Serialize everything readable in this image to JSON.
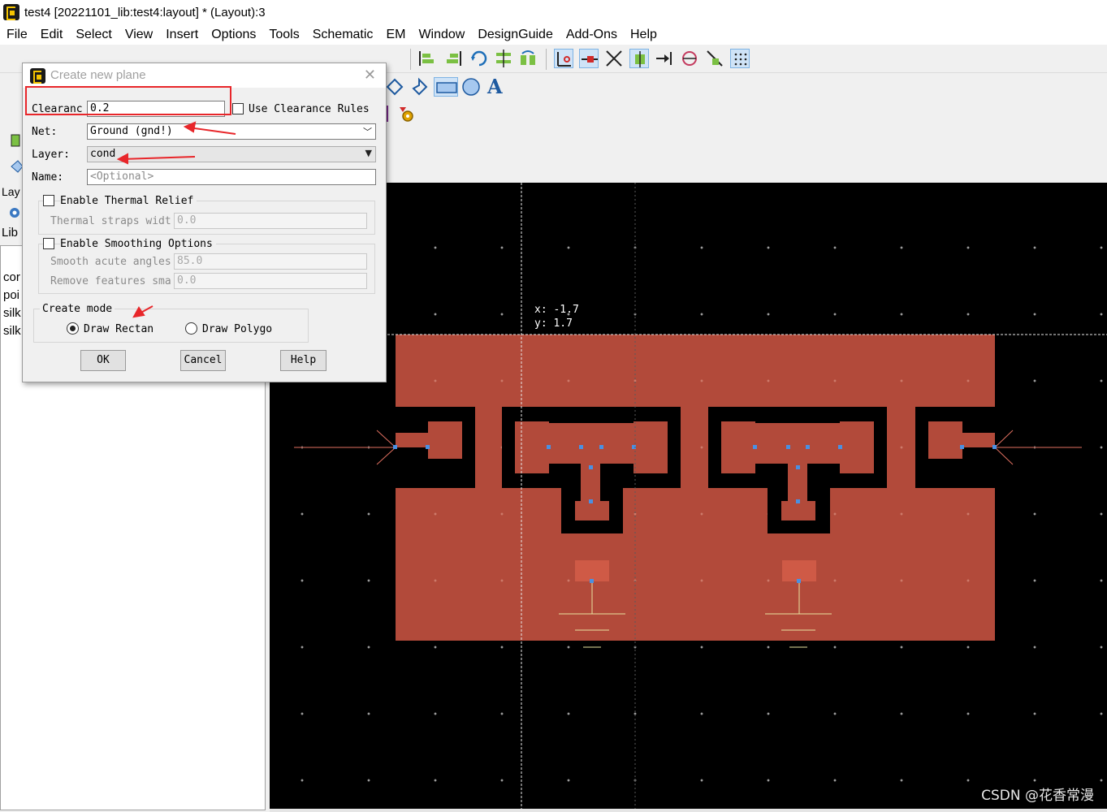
{
  "window": {
    "title": "test4 [20221101_lib:test4:layout] * (Layout):3"
  },
  "menubar": {
    "items": [
      "File",
      "Edit",
      "Select",
      "View",
      "Insert",
      "Options",
      "Tools",
      "Schematic",
      "EM",
      "Window",
      "DesignGuide",
      "Add-Ons",
      "Help"
    ]
  },
  "left_panel": {
    "tab_label": "Lay",
    "lib_label": "Lib",
    "items": [
      "cor",
      "poi",
      "silk",
      "silk"
    ]
  },
  "canvas": {
    "coord_x": "x: -1.7",
    "coord_y": "y: 1.7",
    "background": "#000000",
    "conductor_color": "#b24a3a",
    "pin_color": "#4a90e2",
    "ground_symbol_color": "#e8e4a0"
  },
  "dialog": {
    "title": "Create new plane",
    "clearance_label": "Clearanc",
    "clearance_value": "0.2",
    "use_clearance_rules_label": "Use Clearance Rules",
    "net_label": "Net:",
    "net_value": "Ground (gnd!)",
    "layer_label": "Layer:",
    "layer_value": "cond",
    "name_label": "Name:",
    "name_placeholder": "<Optional>",
    "thermal_relief_label": "Enable Thermal Relief",
    "thermal_straps_label": "Thermal straps widt",
    "thermal_straps_value": "0.0",
    "smoothing_label": "Enable Smoothing Options",
    "smooth_angles_label": "Smooth acute angles",
    "smooth_angles_value": "85.0",
    "remove_features_label": "Remove features sma",
    "remove_features_value": "0.0",
    "create_mode_label": "Create mode",
    "draw_rect_label": "Draw Rectan",
    "draw_poly_label": "Draw Polygo",
    "selected_mode": "Draw Rectan",
    "ok_label": "OK",
    "cancel_label": "Cancel",
    "help_label": "Help"
  },
  "watermark": "CSDN @花香常漫",
  "accent": {
    "annotation_red": "#e8262a"
  }
}
